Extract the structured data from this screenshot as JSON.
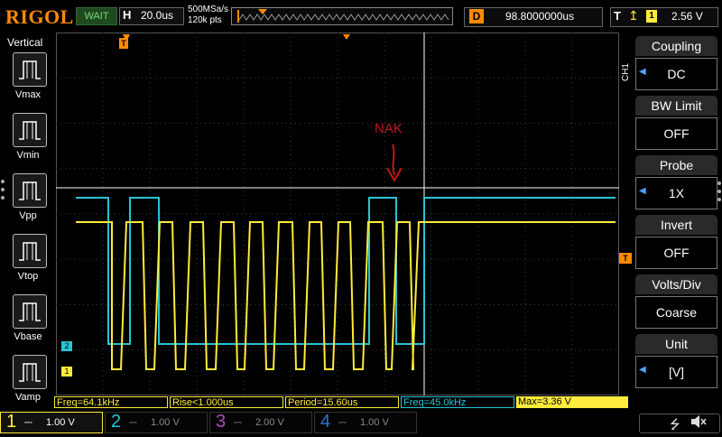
{
  "top": {
    "brand": "RIGOL",
    "trigger_status": "WAIT",
    "timebase_prefix": "H",
    "timebase": "20.0us",
    "sample_rate": "500MSa/s",
    "memory_depth": "120k pts",
    "delay_prefix": "D",
    "delay": "98.8000000us",
    "trigger_prefix": "T",
    "trigger_source": "1",
    "trigger_level": "2.56 V"
  },
  "left_panel": {
    "title": "Vertical",
    "buttons": [
      "Vmax",
      "Vmin",
      "Vpp",
      "Vtop",
      "Vbase",
      "Vamp"
    ]
  },
  "right_panel": {
    "channel": "CH1",
    "items": [
      {
        "title": "Coupling",
        "value": "DC",
        "has_arrow": true
      },
      {
        "title": "BW Limit",
        "value": "OFF",
        "has_arrow": false
      },
      {
        "title": "Probe",
        "value": "1X",
        "has_arrow": true
      },
      {
        "title": "Invert",
        "value": "OFF",
        "has_arrow": false
      },
      {
        "title": "Volts/Div",
        "value": "Coarse",
        "has_arrow": false
      },
      {
        "title": "Unit",
        "value": "[V]",
        "has_arrow": true
      }
    ]
  },
  "screen": {
    "annotation": "NAK",
    "trigger_marker": "T",
    "ch1_marker": "1",
    "ch2_marker": "2"
  },
  "measurements": [
    {
      "label": "Freq=64.1kHz",
      "color": "#ffeb3b"
    },
    {
      "label": "Rise<1.000us",
      "color": "#ffeb3b"
    },
    {
      "label": "Period=15.60us",
      "color": "#ffeb3b"
    },
    {
      "label": "Freq=45.0kHz",
      "color": "#27c4d6"
    },
    {
      "label": "Max=3.36 V",
      "color": "#ffeb3b"
    }
  ],
  "channels": [
    {
      "num": "1",
      "scale": "1.00 V",
      "color": "#ffeb3b",
      "active": true
    },
    {
      "num": "2",
      "scale": "1.00 V",
      "color": "#27c4d6",
      "active": false
    },
    {
      "num": "3",
      "scale": "2.00 V",
      "color": "#b04ab8",
      "active": false
    },
    {
      "num": "4",
      "scale": "1.00 V",
      "color": "#2f6fd6",
      "active": false
    }
  ],
  "colors": {
    "ch1": "#ffeb3b",
    "ch2": "#27c4d6",
    "accent": "#ff8a00",
    "annotation": "#c01818"
  },
  "icons": [
    "usb-icon",
    "speaker-mute-icon"
  ]
}
